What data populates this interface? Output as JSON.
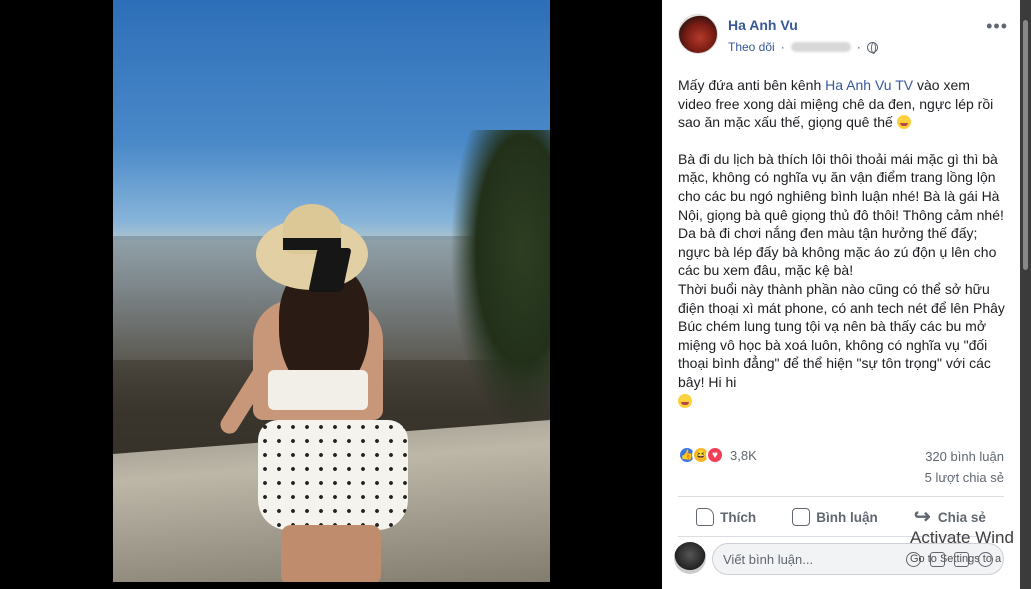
{
  "post": {
    "author": "Ha Anh Vu",
    "follow_label": "Theo dõi",
    "more_label": "•••",
    "text_intro": "Mấy đứa anti bên kênh ",
    "channel_link": "Ha Anh Vu TV",
    "text_intro_rest": " vào xem video free xong dài miệng chê da đen, ngực lép rồi sao ăn mặc xấu thế, giọng quê thế ",
    "text_body": "Bà đi du lịch bà thích lôi thôi thoải mái mặc gì thì bà mặc, không có nghĩa vụ ăn vận điểm trang lồng lộn cho các bu ngó nghiêng bình luận nhé! Bà là gái Hà Nội, giọng bà quê giọng thủ đô thôi! Thông cảm nhé! Da bà đi chơi nắng đen màu tận hưởng thế đấy; ngực bà lép đấy bà không mặc áo zú độn ụ lên cho các bu xem đâu, mặc kệ bà!\nThời buổi này thành phần nào cũng có thể sở hữu điện thoại xì mát phone, có anh tech nét để lên Phây Búc chém lung tung tội vạ nên bà thấy các bu mở miệng vô học bà xoá luôn, không có nghĩa vụ \"đối thoại bình đẳng\" để thể hiện \"sự tôn trọng\" với các bây! Hi hi"
  },
  "reactions": {
    "count": "3,8K",
    "types": [
      "like",
      "haha",
      "love"
    ]
  },
  "stats": {
    "comments": "320 bình luận",
    "shares": "5 lượt chia sẻ"
  },
  "actions": {
    "like": "Thích",
    "comment": "Bình luận",
    "share": "Chia sẻ"
  },
  "comment_box": {
    "placeholder": "Viết bình luận..."
  },
  "watermark": {
    "line1": "Activate Wind",
    "line2": "Go to Settings to a"
  },
  "colors": {
    "link": "#385898",
    "text": "#1c1e21",
    "secondary": "#606770",
    "like_blue": "#3578e5",
    "love_red": "#f33e58",
    "haha_yellow": "#f7b928"
  }
}
